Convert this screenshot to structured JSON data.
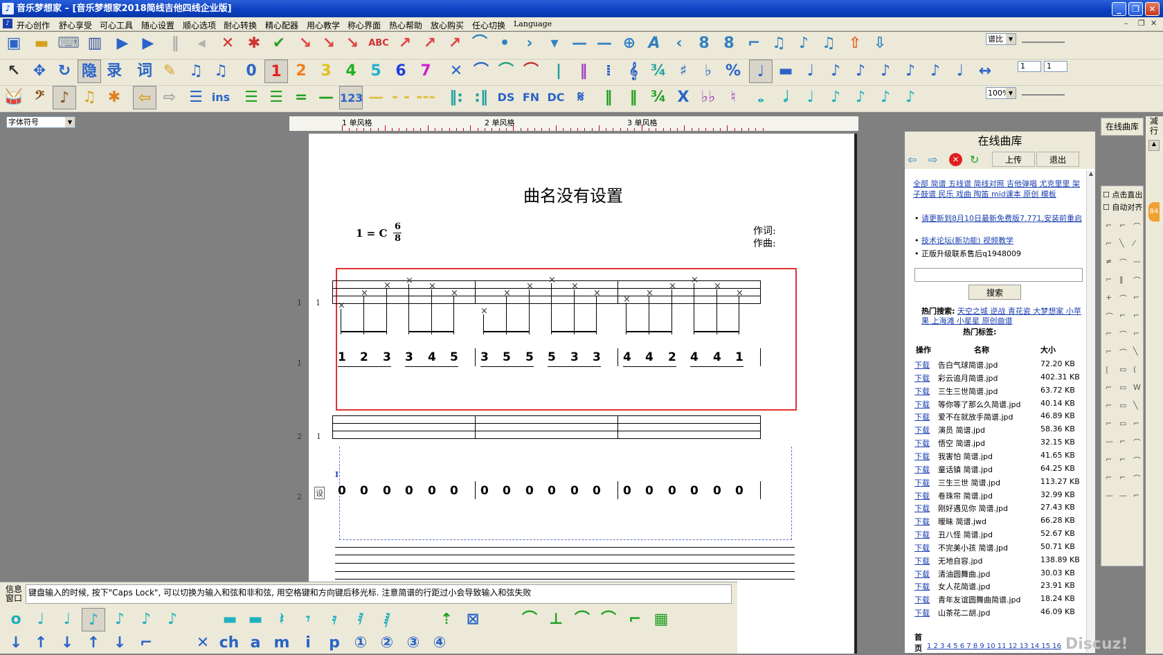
{
  "window": {
    "title": "音乐梦想家 – [音乐梦想家2018简线吉他四线企业版]"
  },
  "menu": [
    "开心创作",
    "舒心享受",
    "可心工具",
    "随心设置",
    "顺心选项",
    "耐心转换",
    "精心配器",
    "用心教学",
    "称心界面",
    "热心帮助",
    "放心购买",
    "任心切换",
    "Language"
  ],
  "toolbar": {
    "ratio_select": "谱比",
    "zoom_select": "100%",
    "spin1": "1",
    "spin2": "1",
    "row2_icons": [
      "隐",
      "录",
      "词"
    ],
    "row3_icons": [
      "ins",
      "123",
      "DS",
      "FN",
      "DC"
    ],
    "font_select": "字体符号"
  },
  "ruler": {
    "labels": [
      "1 单风格",
      "2 单风格",
      "3 单风格"
    ]
  },
  "score": {
    "title": "曲名没有设置",
    "key": "1 = C",
    "time_top": "6",
    "time_bottom": "8",
    "lyricist_label": "作词:",
    "composer_label": "作曲:",
    "numbered_row1": [
      "1",
      "2",
      "3",
      "3",
      "4",
      "5",
      "3",
      "5",
      "5",
      "5",
      "3",
      "3",
      "4",
      "4",
      "2",
      "4",
      "4",
      "1"
    ],
    "numbered_row2": [
      "0",
      "0",
      "0",
      "0",
      "0",
      "0",
      "0",
      "0",
      "0",
      "0",
      "0",
      "0",
      "0",
      "0",
      "0",
      "0",
      "0",
      "0"
    ],
    "row_labels": [
      "1",
      "1",
      "1",
      "2",
      "2",
      "1",
      "2",
      "设"
    ],
    "cursor_label": "I"
  },
  "info": {
    "label": "信息窗口",
    "message": "键盘输入的时候, 按下\"Caps Lock\", 可以切换为输入和弦和非和弦, 用空格键和方向键后移光标. 注意简谱的行距过小会导致输入和弦失败"
  },
  "right_panel": {
    "title": "在线曲库",
    "upload_btn": "上传",
    "exit_btn": "退出",
    "categories": "全部 简谱 五线谱 简线对照 吉他弹唱 尤克里里 架子鼓谱 民乐 戏曲 陶笛 mid课本 原创 模板",
    "bullets": [
      "请更新到8月10日最新免费版7.771,安装前重启",
      "技术论坛(新功能) 视频教学",
      "正版升级联系售后q1948009"
    ],
    "search_btn": "搜索",
    "hot_search_label": "热门搜索:",
    "hot_search": "天空之城 逆战 青花瓷 大梦想家 小苹果 上海滩 小星星 原创曲谱",
    "hot_tags_label": "热门标签:",
    "col_op": "操作",
    "col_name": "名称",
    "col_size": "大小",
    "download_label": "下载",
    "files": [
      {
        "name": "告白气球简谱.jpd",
        "size": "72.20 KB"
      },
      {
        "name": "彩云追月简谱.jpd",
        "size": "402.31 KB"
      },
      {
        "name": "三生三世简谱.jpd",
        "size": "63.72 KB"
      },
      {
        "name": "等你等了那么久简谱.jpd",
        "size": "40.14 KB"
      },
      {
        "name": "爱不在就放手简谱.jpd",
        "size": "46.89 KB"
      },
      {
        "name": "演员 简谱.jpd",
        "size": "58.36 KB"
      },
      {
        "name": "悟空 简谱.jpd",
        "size": "32.15 KB"
      },
      {
        "name": "我害怕 简谱.jpd",
        "size": "41.65 KB"
      },
      {
        "name": "童话镇 简谱.jpd",
        "size": "64.25 KB"
      },
      {
        "name": "三生三世 简谱.jpd",
        "size": "113.27 KB"
      },
      {
        "name": "卷珠帘 简谱.jpd",
        "size": "32.99 KB"
      },
      {
        "name": "刚好遇见你 简谱.jpd",
        "size": "27.43 KB"
      },
      {
        "name": "暧昧 简谱.jwd",
        "size": "66.28 KB"
      },
      {
        "name": "丑八怪 简谱.jpd",
        "size": "52.67 KB"
      },
      {
        "name": "不完美小孩 简谱.jpd",
        "size": "50.71 KB"
      },
      {
        "name": "无地自容.jpd",
        "size": "138.89 KB"
      },
      {
        "name": "清油圆舞曲.jpd",
        "size": "30.03 KB"
      },
      {
        "name": "女人花简谱.jpd",
        "size": "23.91 KB"
      },
      {
        "name": "青年友谊圆舞曲简谱.jpd",
        "size": "18.24 KB"
      },
      {
        "name": "山茶花二胡.jpd",
        "size": "46.09 KB"
      }
    ],
    "pager_first": "首",
    "pager_page": "页",
    "pager": "1 2 3 4 5 6 7 8 9 10 11 12 13 14 15 16"
  },
  "side": {
    "online_btn": "在线曲库",
    "checkbox1": "点击直出",
    "checkbox2": "自动对齐",
    "badge": "84",
    "vertical": "减行"
  },
  "watermark": "Discuz!"
}
